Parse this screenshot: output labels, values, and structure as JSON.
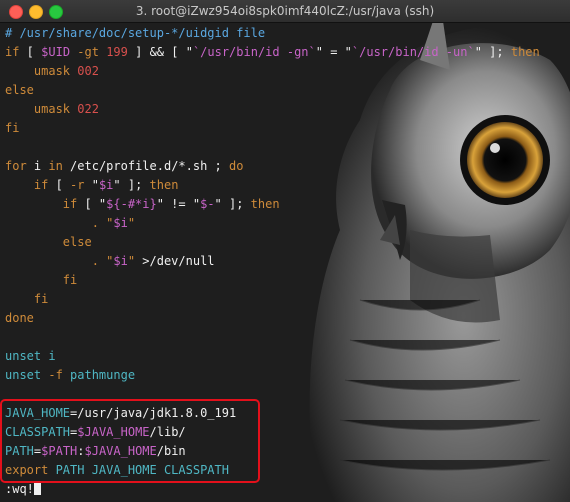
{
  "window": {
    "title": "3. root@iZwz954oi8spk0imf440lcZ:/usr/java (ssh)"
  },
  "editor": {
    "lines": [
      [
        {
          "t": "# /usr/share/doc/setup-*/uidgid file",
          "c": "com"
        }
      ],
      [
        {
          "t": "if",
          "c": "kw"
        },
        {
          "t": " [ ",
          "c": "fg"
        },
        {
          "t": "$UID",
          "c": "var"
        },
        {
          "t": " ",
          "c": "fg"
        },
        {
          "t": "-gt",
          "c": "kw"
        },
        {
          "t": " ",
          "c": "fg"
        },
        {
          "t": "199",
          "c": "num"
        },
        {
          "t": " ] ",
          "c": "fg"
        },
        {
          "t": "&&",
          "c": "fg"
        },
        {
          "t": " [ \"",
          "c": "fg"
        },
        {
          "t": "`/usr/bin/id -gn`",
          "c": "var"
        },
        {
          "t": "\" = \"",
          "c": "fg"
        },
        {
          "t": "`/usr/bin/id -un`",
          "c": "var"
        },
        {
          "t": "\" ]; ",
          "c": "fg"
        },
        {
          "t": "then",
          "c": "kw"
        }
      ],
      [
        {
          "t": "    umask ",
          "c": "kw"
        },
        {
          "t": "002",
          "c": "num"
        }
      ],
      [
        {
          "t": "else",
          "c": "kw"
        }
      ],
      [
        {
          "t": "    umask ",
          "c": "kw"
        },
        {
          "t": "022",
          "c": "num"
        }
      ],
      [
        {
          "t": "fi",
          "c": "kw"
        }
      ],
      [],
      [
        {
          "t": "for",
          "c": "kw"
        },
        {
          "t": " i ",
          "c": "fg"
        },
        {
          "t": "in",
          "c": "kw"
        },
        {
          "t": " /etc/profile.d/*.sh ; ",
          "c": "fg"
        },
        {
          "t": "do",
          "c": "kw"
        }
      ],
      [
        {
          "t": "    if",
          "c": "kw"
        },
        {
          "t": " [ ",
          "c": "fg"
        },
        {
          "t": "-r",
          "c": "kw"
        },
        {
          "t": " \"",
          "c": "fg"
        },
        {
          "t": "$i",
          "c": "var"
        },
        {
          "t": "\" ]; ",
          "c": "fg"
        },
        {
          "t": "then",
          "c": "kw"
        }
      ],
      [
        {
          "t": "        if",
          "c": "kw"
        },
        {
          "t": " [ \"",
          "c": "fg"
        },
        {
          "t": "${-#*i}",
          "c": "var"
        },
        {
          "t": "\" != \"",
          "c": "fg"
        },
        {
          "t": "$-",
          "c": "var"
        },
        {
          "t": "\" ]; ",
          "c": "fg"
        },
        {
          "t": "then",
          "c": "kw"
        }
      ],
      [
        {
          "t": "            . \"",
          "c": "kw"
        },
        {
          "t": "$i",
          "c": "var"
        },
        {
          "t": "\"",
          "c": "kw"
        }
      ],
      [
        {
          "t": "        else",
          "c": "kw"
        }
      ],
      [
        {
          "t": "            . \"",
          "c": "kw"
        },
        {
          "t": "$i",
          "c": "var"
        },
        {
          "t": "\" ",
          "c": "kw"
        },
        {
          "t": ">/dev/null",
          "c": "fg"
        }
      ],
      [
        {
          "t": "        fi",
          "c": "kw"
        }
      ],
      [
        {
          "t": "    fi",
          "c": "kw"
        }
      ],
      [
        {
          "t": "done",
          "c": "kw"
        }
      ],
      [],
      [
        {
          "t": "unset ",
          "c": "cy"
        },
        {
          "t": "i",
          "c": "cy"
        }
      ],
      [
        {
          "t": "unset ",
          "c": "cy"
        },
        {
          "t": "-f",
          "c": "kw"
        },
        {
          "t": " pathmunge",
          "c": "cy"
        }
      ],
      [],
      [
        {
          "t": "JAVA_HOME",
          "c": "cy"
        },
        {
          "t": "=/usr/java/jdk1.8.0_191",
          "c": "fg"
        }
      ],
      [
        {
          "t": "CLASSPATH",
          "c": "cy"
        },
        {
          "t": "=",
          "c": "fg"
        },
        {
          "t": "$JAVA_HOME",
          "c": "var"
        },
        {
          "t": "/lib/",
          "c": "fg"
        }
      ],
      [
        {
          "t": "PATH",
          "c": "cy"
        },
        {
          "t": "=",
          "c": "fg"
        },
        {
          "t": "$PATH",
          "c": "var"
        },
        {
          "t": ":",
          "c": "fg"
        },
        {
          "t": "$JAVA_HOME",
          "c": "var"
        },
        {
          "t": "/bin",
          "c": "fg"
        }
      ],
      [
        {
          "t": "export",
          "c": "kw"
        },
        {
          "t": " PATH JAVA_HOME CLASSPATH",
          "c": "cy"
        }
      ],
      [
        {
          "t": ":wq!",
          "c": "fg"
        }
      ]
    ]
  },
  "colors": {
    "accent_highlight": "#e3101b",
    "close": "#fe5f57",
    "minimize": "#febc2e",
    "maximize": "#28c840"
  },
  "icons": {
    "close": "close-dot-icon",
    "minimize": "minimize-dot-icon",
    "maximize": "maximize-dot-icon",
    "background": "owl-wallpaper"
  }
}
